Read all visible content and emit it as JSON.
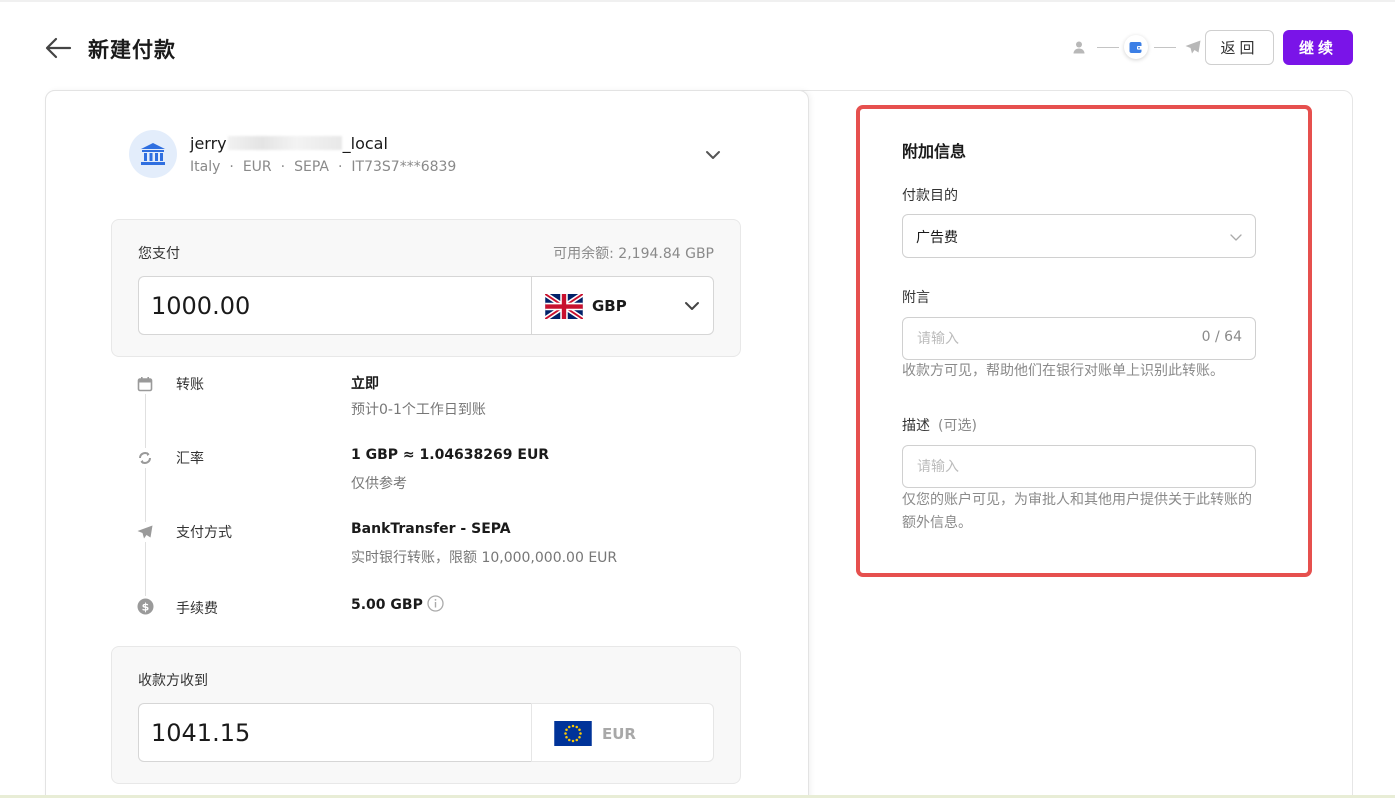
{
  "header": {
    "title": "新建付款",
    "back_button": "返回",
    "continue_button": "继续"
  },
  "recipient": {
    "name_prefix": "jerry",
    "name_suffix": "_local",
    "country": "Italy",
    "currency": "EUR",
    "method": "SEPA",
    "iban": "IT73S7***6839"
  },
  "pay": {
    "label": "您支付",
    "balance": "可用余额: 2,194.84 GBP",
    "amount": "1000.00",
    "currency": "GBP"
  },
  "details": [
    {
      "label": "转账",
      "value": "立即",
      "sub": "预计0-1个工作日到账"
    },
    {
      "label": "汇率",
      "value": "1 GBP ≈ 1.04638269 EUR",
      "sub": "仅供参考"
    },
    {
      "label": "支付方式",
      "value": "BankTransfer - SEPA",
      "sub": "实时银行转账，限额 10,000,000.00 EUR"
    },
    {
      "label": "手续费",
      "value": "5.00 GBP",
      "sub": ""
    }
  ],
  "receive": {
    "label": "收款方收到",
    "amount": "1041.15",
    "currency": "EUR"
  },
  "additional": {
    "title": "附加信息",
    "purpose_label": "付款目的",
    "purpose_value": "广告费",
    "memo_label": "附言",
    "memo_placeholder": "请输入",
    "memo_count": "0 / 64",
    "memo_help": "收款方可见，帮助他们在银行对账单上识别此转账。",
    "desc_label": "描述",
    "desc_optional": "(可选)",
    "desc_placeholder": "请输入",
    "desc_help": "仅您的账户可见，为审批人和其他用户提供关于此转账的额外信息。"
  },
  "colors": {
    "accent": "#7a14e8",
    "highlight": "#e6504e",
    "bank_icon": "#2f6fe0"
  }
}
